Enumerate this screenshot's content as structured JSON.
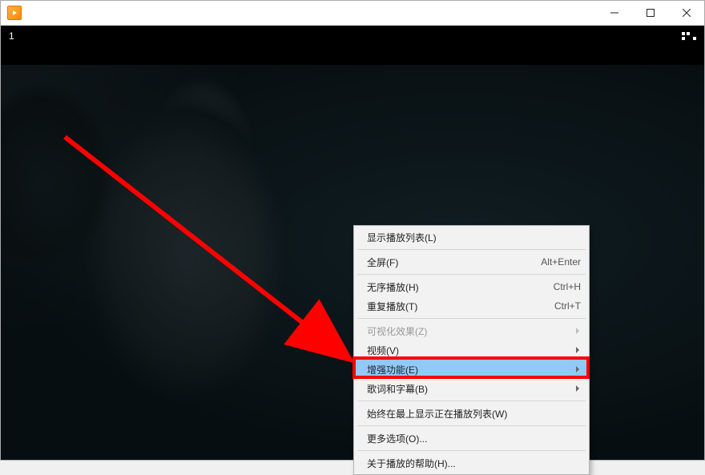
{
  "subbar": {
    "title": "1"
  },
  "menu": {
    "show_playlist": "显示播放列表(L)",
    "fullscreen": {
      "label": "全屏(F)",
      "shortcut": "Alt+Enter"
    },
    "shuffle": {
      "label": "无序播放(H)",
      "shortcut": "Ctrl+H"
    },
    "repeat": {
      "label": "重复播放(T)",
      "shortcut": "Ctrl+T"
    },
    "visualizations": "可视化效果(Z)",
    "video": "视频(V)",
    "enhancements": "增强功能(E)",
    "lyrics": "歌词和字幕(B)",
    "always_on_top": "始终在最上显示正在播放列表(W)",
    "more_options": "更多选项(O)...",
    "about_help": "关于播放的帮助(H)..."
  }
}
